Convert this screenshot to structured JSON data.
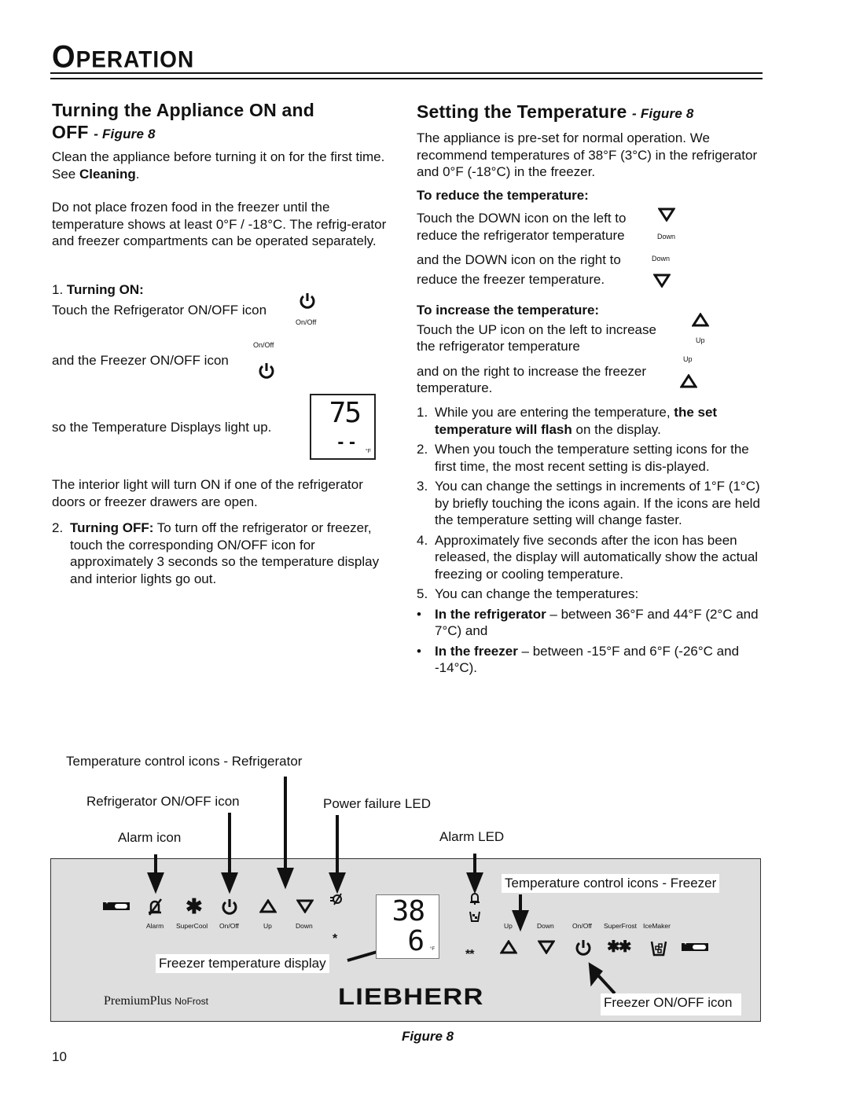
{
  "header": {
    "title_first": "O",
    "title_rest": "PERATION"
  },
  "left": {
    "heading_line1": "Turning the Appliance ON and",
    "heading_line2": "OFF",
    "heading_fig": "- Figure 8",
    "p1_a": "Clean the appliance before turning it on for the first time. See ",
    "p1_b": "Cleaning",
    "p1_c": ".",
    "p2": "Do not place frozen food in the freezer until the temperature shows at least 0°F / -18°C. The refrig-erator and freezer compartments can be operated separately.",
    "step1_num": "1.",
    "step1_title": "Turning ON:",
    "step1_line1": "Touch the Refrigerator ON/OFF icon",
    "step1_line2": "and the Freezer ON/OFF icon",
    "step1_line3": "so the Temperature Displays light up.",
    "onoff_label": "On/Off",
    "display_top": "75",
    "display_bottom": "- -",
    "display_unit": "°F",
    "p3": "The interior light will turn ON if one of the refrigerator doors or freezer drawers are open.",
    "step2_num": "2.",
    "step2_title": "Turning OFF:",
    "step2_text": " To turn off the refrigerator or freezer, touch the corresponding ON/OFF icon for approximately 3 seconds so the temperature display and interior lights go out."
  },
  "right": {
    "heading": "Setting the Temperature",
    "heading_fig": "- Figure 8",
    "intro": "The appliance is pre-set for normal operation. We recommend temperatures of 38°F (3°C) in the refrigerator and 0°F (-18°C) in the freezer.",
    "reduce_heading": "To reduce the temperature:",
    "reduce_l1": "Touch the DOWN icon on the left to",
    "reduce_l2": "reduce the refrigerator temperature",
    "reduce_l3": "and the DOWN icon on the right to",
    "reduce_l4": "reduce the freezer temperature.",
    "down_label": "Down",
    "increase_heading": "To increase the temperature:",
    "increase_l1": "Touch the UP icon on the left to increase",
    "increase_l2": "the refrigerator temperature",
    "increase_l3": "and on the right to increase the freezer",
    "increase_l4": "temperature.",
    "up_label": "Up",
    "steps": [
      {
        "n": "1.",
        "a": "While you are entering the temperature, ",
        "b": "the set temperature will flash",
        "c": " on the display."
      },
      {
        "n": "2.",
        "a": "When you touch the temperature setting icons for the first time, the most recent setting is dis-played.",
        "b": "",
        "c": ""
      },
      {
        "n": "3.",
        "a": "You can change the settings in increments of 1°F (1°C) by briefly touching the icons again. If the icons are held the temperature setting will change faster.",
        "b": "",
        "c": ""
      },
      {
        "n": "4.",
        "a": "Approximately five seconds after the icon has been released, the display will automatically show the actual freezing or cooling temperature.",
        "b": "",
        "c": ""
      },
      {
        "n": "5.",
        "a": "You can change the temperatures:",
        "b": "",
        "c": ""
      }
    ],
    "bullets": [
      {
        "b": "In the refrigerator",
        "t": " – between 36°F and 44°F (2°C and 7°C) and"
      },
      {
        "b": "In the freezer",
        "t": " – between -15°F and 6°F (-26°C and -14°C)."
      }
    ]
  },
  "figure": {
    "callouts": {
      "temp_ctrl_fridge": "Temperature control icons - Refrigerator",
      "fridge_onoff": "Refrigerator ON/OFF icon",
      "power_failure": "Power failure LED",
      "alarm_icon": "Alarm icon",
      "alarm_led": "Alarm LED",
      "temp_ctrl_freezer": "Temperature control icons - Freezer",
      "freezer_display": "Freezer temperature display",
      "freezer_onoff": "Freezer ON/OFF icon"
    },
    "left_labels": [
      "Alarm",
      "SuperCool",
      "On/Off",
      "Up",
      "Down"
    ],
    "right_labels": [
      "Up",
      "Down",
      "On/Off",
      "SuperFrost",
      "IceMaker"
    ],
    "display_top": "38",
    "display_bottom": "6",
    "display_unit": "°F",
    "brand": "LIEBHERR",
    "model_a": "PremiumPlus",
    "model_b": "NoFrost",
    "caption": "Figure 8"
  },
  "footer": {
    "page_number": "10"
  }
}
